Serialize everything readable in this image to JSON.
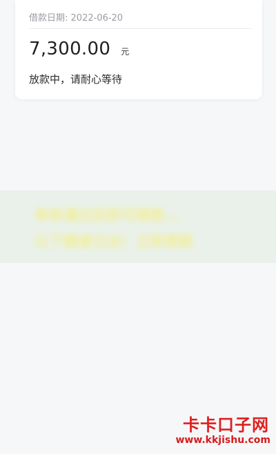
{
  "loan_card": {
    "date_label": "借款日期:",
    "date_value": "2022-06-20",
    "amount": "7,300.00",
    "unit": "元",
    "status": "放款中，请耐心等待"
  },
  "banner": {
    "line1": "审核通过后即可提款...",
    "line2": "以下额度已出！立即提款"
  },
  "watermark": {
    "name": "卡卡口子网",
    "url": "www.kkjishu.com"
  }
}
